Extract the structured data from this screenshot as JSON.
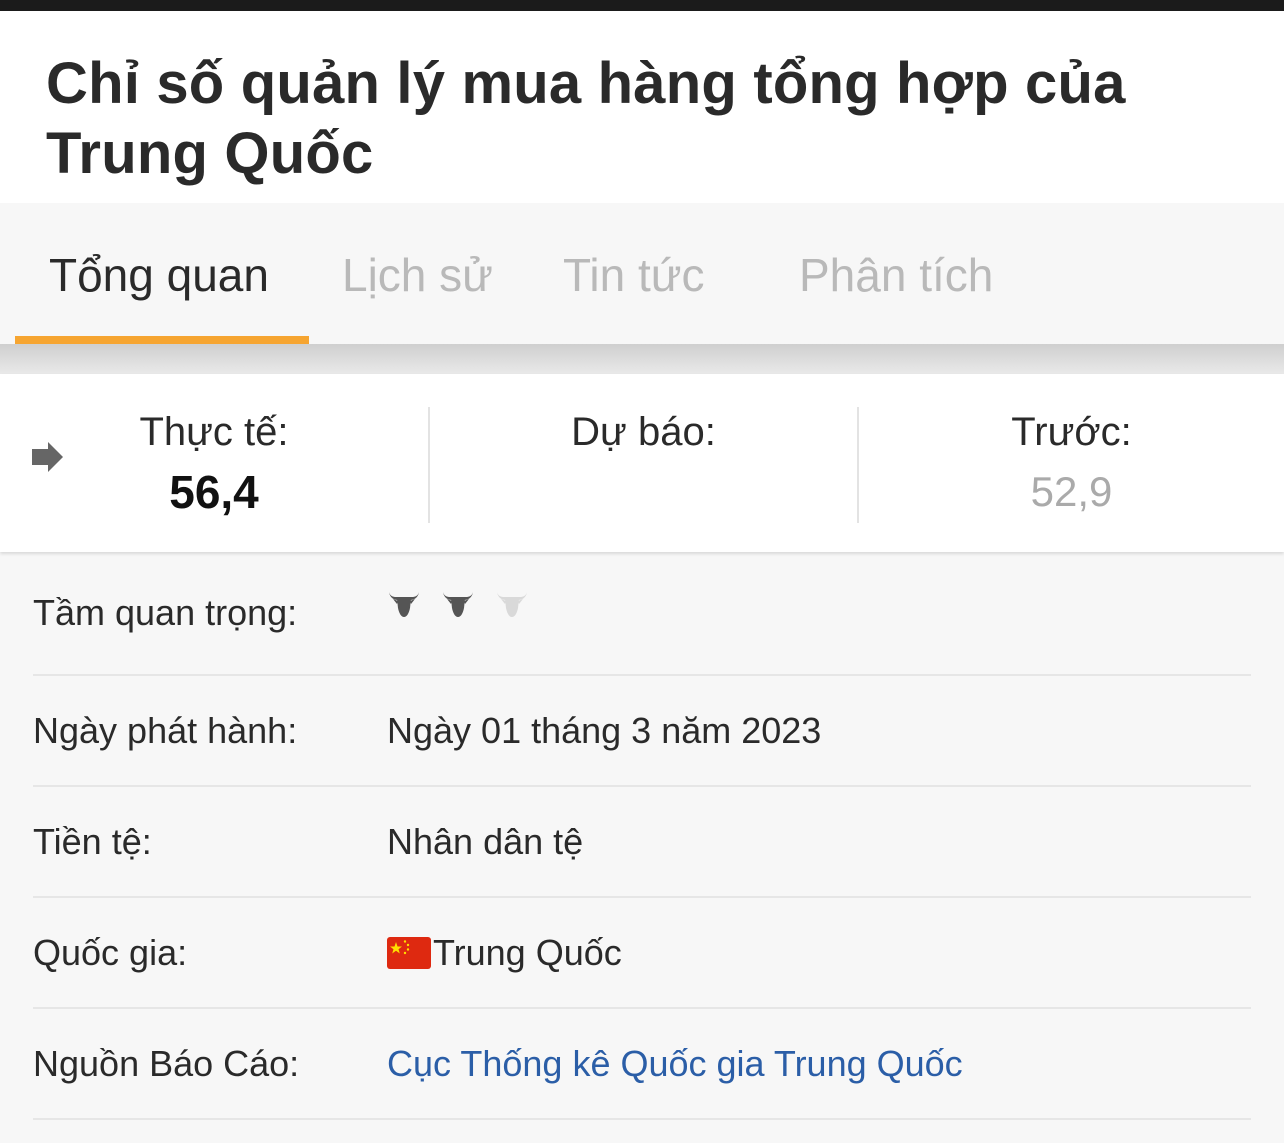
{
  "header": {
    "title": "Chỉ số quản lý mua hàng tổng hợp của Trung Quốc"
  },
  "tabs": [
    {
      "label": "Tổng quan",
      "active": true
    },
    {
      "label": "Lịch sử",
      "active": false
    },
    {
      "label": "Tin tức",
      "active": false
    },
    {
      "label": "Phân tích",
      "active": false
    }
  ],
  "stats": {
    "actual": {
      "label": "Thực tế:",
      "value": "56,4"
    },
    "forecast": {
      "label": "Dự báo:",
      "value": ""
    },
    "previous": {
      "label": "Trước:",
      "value": "52,9"
    },
    "trend_icon": "arrow-right-icon"
  },
  "details": {
    "importance": {
      "label": "Tầm quan trọng:",
      "level": 2,
      "max": 3,
      "icon": "bull-icon"
    },
    "release_date": {
      "label": "Ngày phát hành:",
      "value": "Ngày 01 tháng 3 năm 2023"
    },
    "currency": {
      "label": "Tiền tệ:",
      "value": "Nhân dân tệ"
    },
    "country": {
      "label": "Quốc gia:",
      "value": "Trung Quốc",
      "flag_icon": "china-flag-icon"
    },
    "source": {
      "label": "Nguồn Báo Cáo:",
      "value": "Cục Thống kê Quốc gia Trung Quốc"
    }
  },
  "colors": {
    "accent": "#f6a531",
    "link": "#2b5ea7",
    "bull_active": "#555555",
    "bull_inactive": "#d9d9d9"
  }
}
